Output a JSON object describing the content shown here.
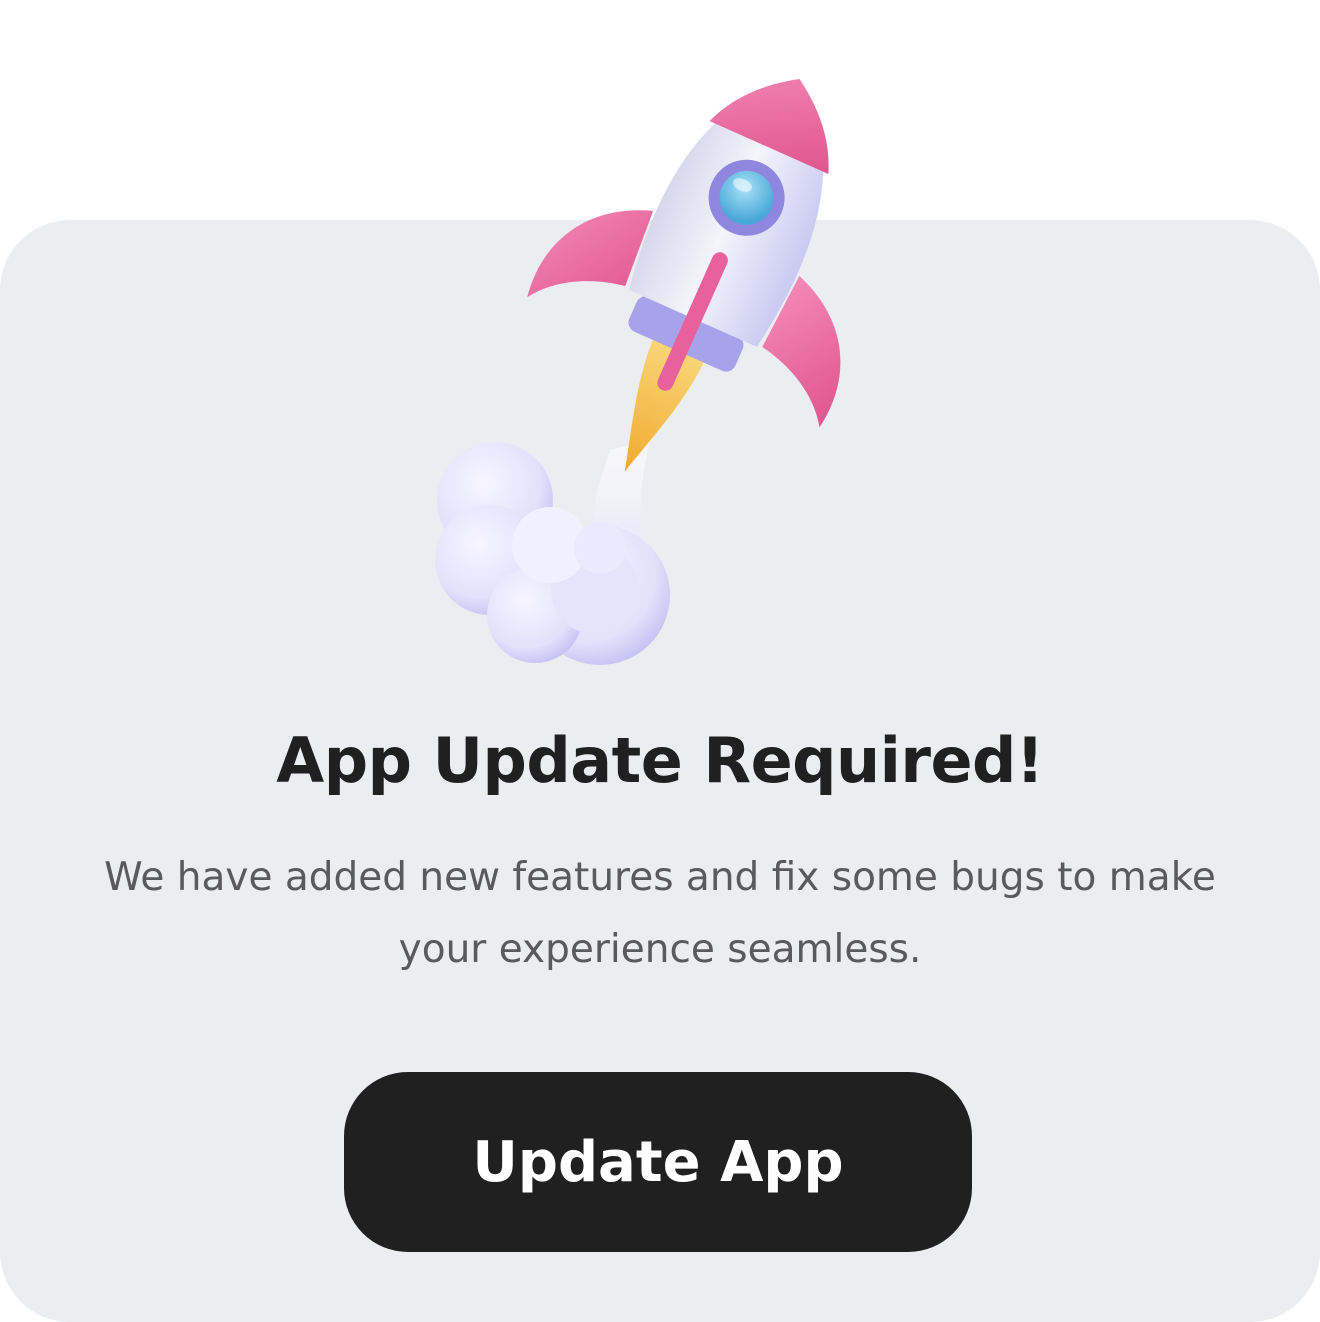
{
  "dialog": {
    "title": "App Update Required!",
    "message": "We have added new features and fix some bugs to make your experience seamless.",
    "button_label": "Update App"
  },
  "illustration": {
    "icon": "rocket-launch-icon"
  },
  "colors": {
    "page_background": "#ffffff",
    "card_background": "#ecedf1",
    "title_text": "#202020",
    "body_text": "#5a5a5c",
    "button_background": "#202020",
    "button_text": "#ffffff",
    "rocket_pink": "#e8609c",
    "rocket_body": "#e6e6fb",
    "flame_yellow": "#f6c04a",
    "window_blue": "#6ec3ea"
  }
}
